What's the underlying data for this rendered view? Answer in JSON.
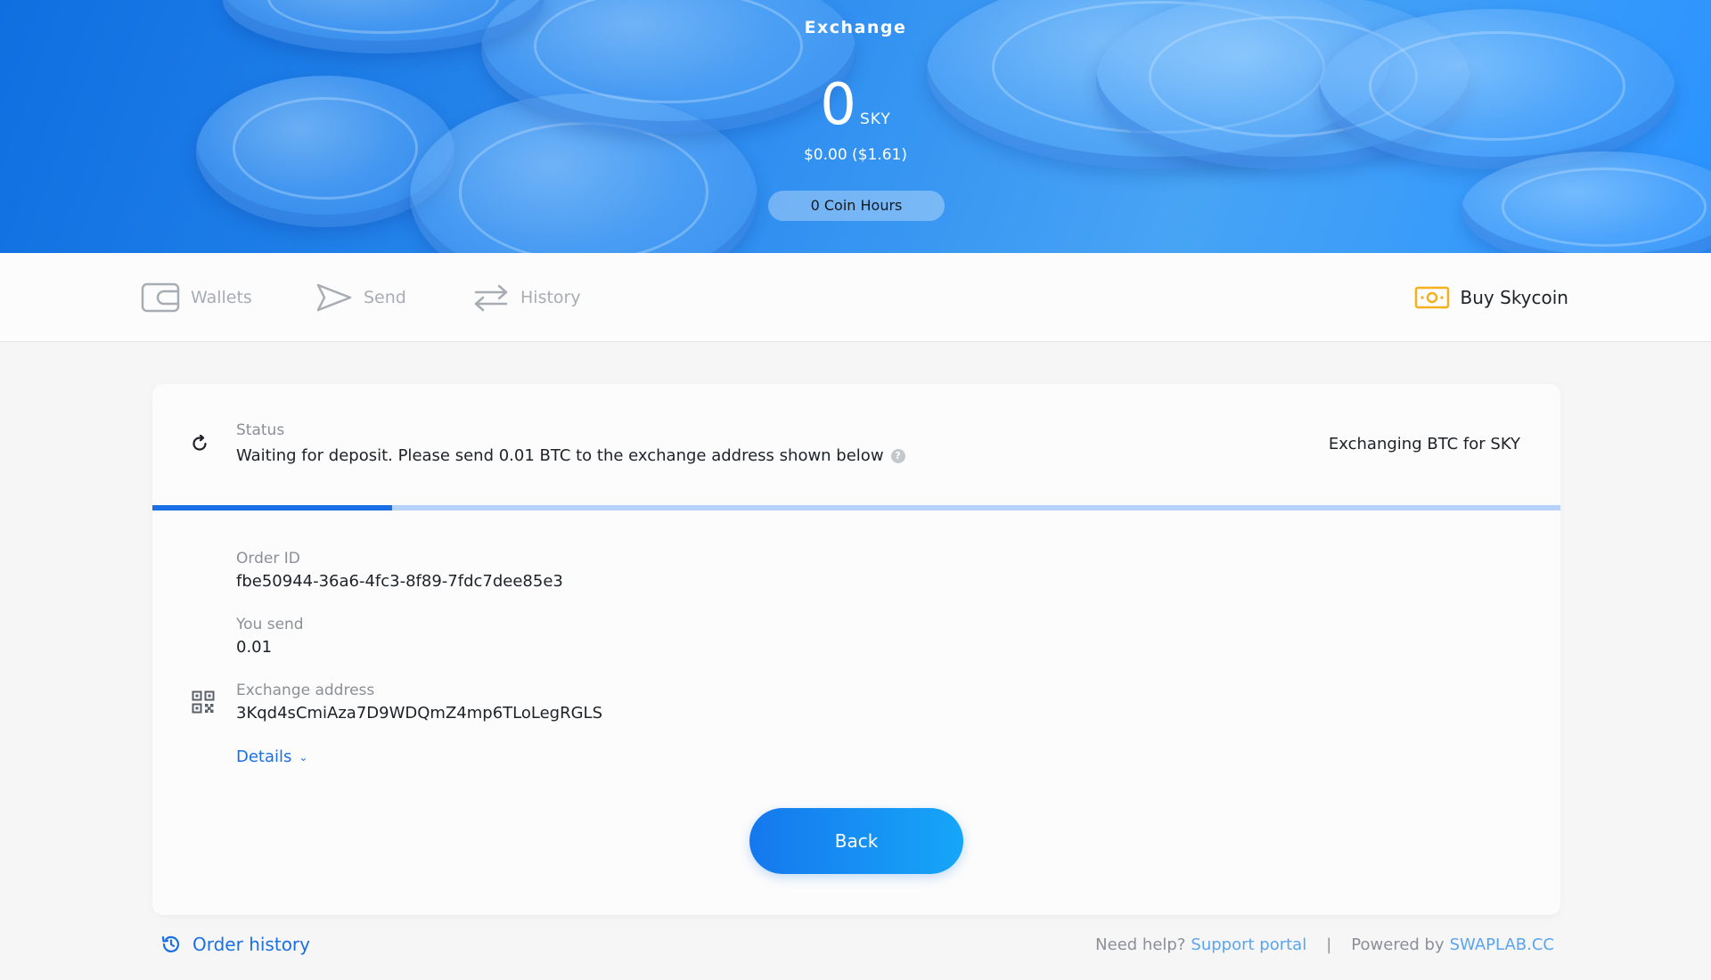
{
  "header": {
    "title": "Exchange",
    "balance": "0",
    "balance_unit": "SKY",
    "usd_value": "$0.00 ($1.61)",
    "coin_hours": "0 Coin Hours"
  },
  "nav": {
    "items": [
      {
        "label": "Wallets",
        "icon": "wallet-icon"
      },
      {
        "label": "Send",
        "icon": "send-icon"
      },
      {
        "label": "History",
        "icon": "history-arrows-icon"
      }
    ],
    "buy_label": "Buy Skycoin",
    "buy_icon": "banknote-icon"
  },
  "status": {
    "label": "Status",
    "text": "Waiting for deposit. Please send 0.01 BTC to the exchange address shown below",
    "pair": "Exchanging BTC for SKY",
    "progress": 0.17
  },
  "fields": {
    "order_id_label": "Order ID",
    "order_id": "fbe50944-36a6-4fc3-8f89-7fdc7dee85e3",
    "you_send_label": "You send",
    "you_send": "0.01",
    "address_label": "Exchange address",
    "address": "3Kqd4sCmiAza7D9WDQmZ4mp6TLoLegRGLS"
  },
  "details_label": "Details",
  "back_label": "Back",
  "footer": {
    "order_history": "Order history",
    "need_help": "Need help?",
    "support_portal": "Support portal",
    "separator": "|",
    "powered_by": "Powered by",
    "swaplab": "SWAPLAB.CC"
  },
  "colors": {
    "accent": "#1a6fe6",
    "buy_icon": "#f5b01e",
    "progress_track": "#b7d3fb"
  }
}
